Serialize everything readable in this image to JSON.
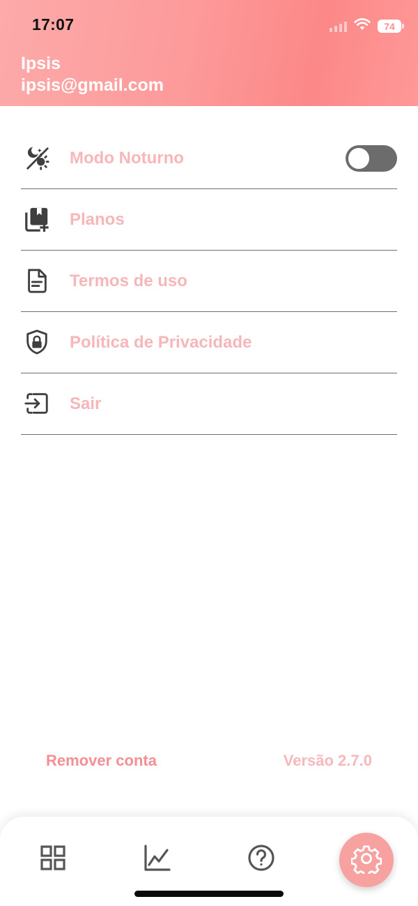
{
  "status_bar": {
    "time": "17:07",
    "battery": "74"
  },
  "user": {
    "name": "Ipsis",
    "email": "ipsis@gmail.com"
  },
  "menu": {
    "items": [
      {
        "label": "Modo Noturno",
        "icon": "night-mode-icon",
        "has_toggle": true,
        "toggle_on": false
      },
      {
        "label": "Planos",
        "icon": "add-plan-icon"
      },
      {
        "label": "Termos de uso",
        "icon": "document-icon"
      },
      {
        "label": "Política de Privacidade",
        "icon": "shield-lock-icon"
      },
      {
        "label": "Sair",
        "icon": "logout-icon"
      }
    ]
  },
  "footer": {
    "remove_account": "Remover conta",
    "version": "Versão 2.7.0"
  },
  "tabbar": {
    "active": "settings",
    "tabs": [
      "dashboard-icon",
      "chart-icon",
      "help-icon",
      "gear-icon"
    ]
  },
  "colors": {
    "header_start": "#fdaaaa",
    "header_end": "#fc8888",
    "label": "#f7b6b9",
    "remove": "#f48f95",
    "accent": "#f7a1a1"
  }
}
